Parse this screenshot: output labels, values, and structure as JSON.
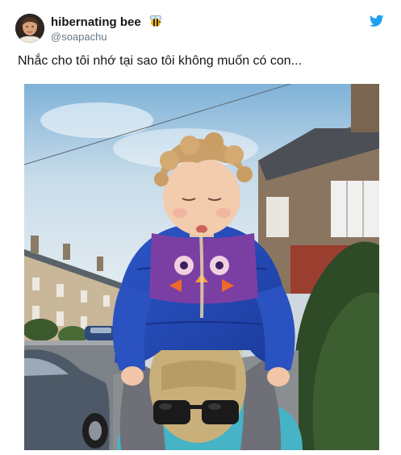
{
  "tweet": {
    "display_name": "hibernating bee",
    "handle": "@soapachu",
    "text": "Nhắc cho tôi nhớ tại sao tôi không muốn có con...",
    "name_emoji": "bee-icon",
    "platform_icon": "twitter-bird-icon"
  },
  "colors": {
    "twitter_blue": "#1da1f2",
    "name_color": "#14171a",
    "handle_color": "#657786"
  }
}
